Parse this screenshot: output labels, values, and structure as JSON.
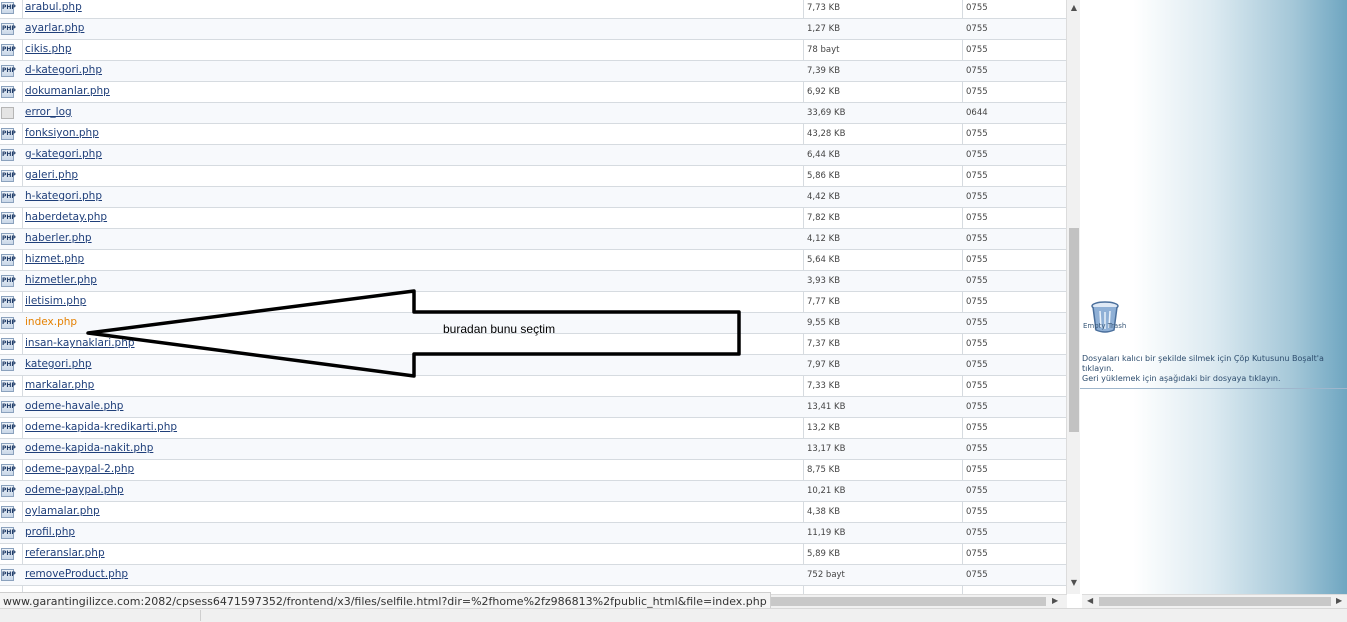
{
  "files": [
    {
      "name": "arabul.php",
      "size": "7,73 KB",
      "perm": "0755",
      "type": "php"
    },
    {
      "name": "ayarlar.php",
      "size": "1,27 KB",
      "perm": "0755",
      "type": "php"
    },
    {
      "name": "cikis.php",
      "size": "78 bayt",
      "perm": "0755",
      "type": "php"
    },
    {
      "name": "d-kategori.php",
      "size": "7,39 KB",
      "perm": "0755",
      "type": "php"
    },
    {
      "name": "dokumanlar.php",
      "size": "6,92 KB",
      "perm": "0755",
      "type": "php"
    },
    {
      "name": "error_log",
      "size": "33,69 KB",
      "perm": "0644",
      "type": "log"
    },
    {
      "name": "fonksiyon.php",
      "size": "43,28 KB",
      "perm": "0755",
      "type": "php"
    },
    {
      "name": "g-kategori.php",
      "size": "6,44 KB",
      "perm": "0755",
      "type": "php"
    },
    {
      "name": "galeri.php",
      "size": "5,86 KB",
      "perm": "0755",
      "type": "php"
    },
    {
      "name": "h-kategori.php",
      "size": "4,42 KB",
      "perm": "0755",
      "type": "php"
    },
    {
      "name": "haberdetay.php",
      "size": "7,82 KB",
      "perm": "0755",
      "type": "php"
    },
    {
      "name": "haberler.php",
      "size": "4,12 KB",
      "perm": "0755",
      "type": "php"
    },
    {
      "name": "hizmet.php",
      "size": "5,64 KB",
      "perm": "0755",
      "type": "php"
    },
    {
      "name": "hizmetler.php",
      "size": "3,93 KB",
      "perm": "0755",
      "type": "php"
    },
    {
      "name": "iletisim.php",
      "size": "7,77 KB",
      "perm": "0755",
      "type": "php"
    },
    {
      "name": "index.php",
      "size": "9,55 KB",
      "perm": "0755",
      "type": "php",
      "active": true
    },
    {
      "name": "insan-kaynaklari.php",
      "size": "7,37 KB",
      "perm": "0755",
      "type": "php"
    },
    {
      "name": "kategori.php",
      "size": "7,97 KB",
      "perm": "0755",
      "type": "php"
    },
    {
      "name": "markalar.php",
      "size": "7,33 KB",
      "perm": "0755",
      "type": "php"
    },
    {
      "name": "odeme-havale.php",
      "size": "13,41 KB",
      "perm": "0755",
      "type": "php"
    },
    {
      "name": "odeme-kapida-kredikarti.php",
      "size": "13,2 KB",
      "perm": "0755",
      "type": "php"
    },
    {
      "name": "odeme-kapida-nakit.php",
      "size": "13,17 KB",
      "perm": "0755",
      "type": "php"
    },
    {
      "name": "odeme-paypal-2.php",
      "size": "8,75 KB",
      "perm": "0755",
      "type": "php"
    },
    {
      "name": "odeme-paypal.php",
      "size": "10,21 KB",
      "perm": "0755",
      "type": "php"
    },
    {
      "name": "oylamalar.php",
      "size": "4,38 KB",
      "perm": "0755",
      "type": "php"
    },
    {
      "name": "profil.php",
      "size": "11,19 KB",
      "perm": "0755",
      "type": "php"
    },
    {
      "name": "referanslar.php",
      "size": "5,89 KB",
      "perm": "0755",
      "type": "php"
    },
    {
      "name": "removeProduct.php",
      "size": "752 bayt",
      "perm": "0755",
      "type": "php"
    }
  ],
  "php_icon_text": "PHP",
  "trash": {
    "label": "Empty Trash",
    "info_line1": "Dosyaları kalıcı bir şekilde silmek için Çöp Kutusunu Boşalt'a tıklayın.",
    "info_line2": "Geri yüklemek için aşağıdaki bir dosyaya tıklayın."
  },
  "annotation": {
    "text": "buradan bunu seçtim"
  },
  "status_url": "www.garantingilizce.com:2082/cpsess6471597352/frontend/x3/files/selfile.html?dir=%2fhome%2fz986813%2fpublic_html&file=index.php",
  "colors": {
    "active_file": "#e58100",
    "link": "#1f3f7a"
  }
}
